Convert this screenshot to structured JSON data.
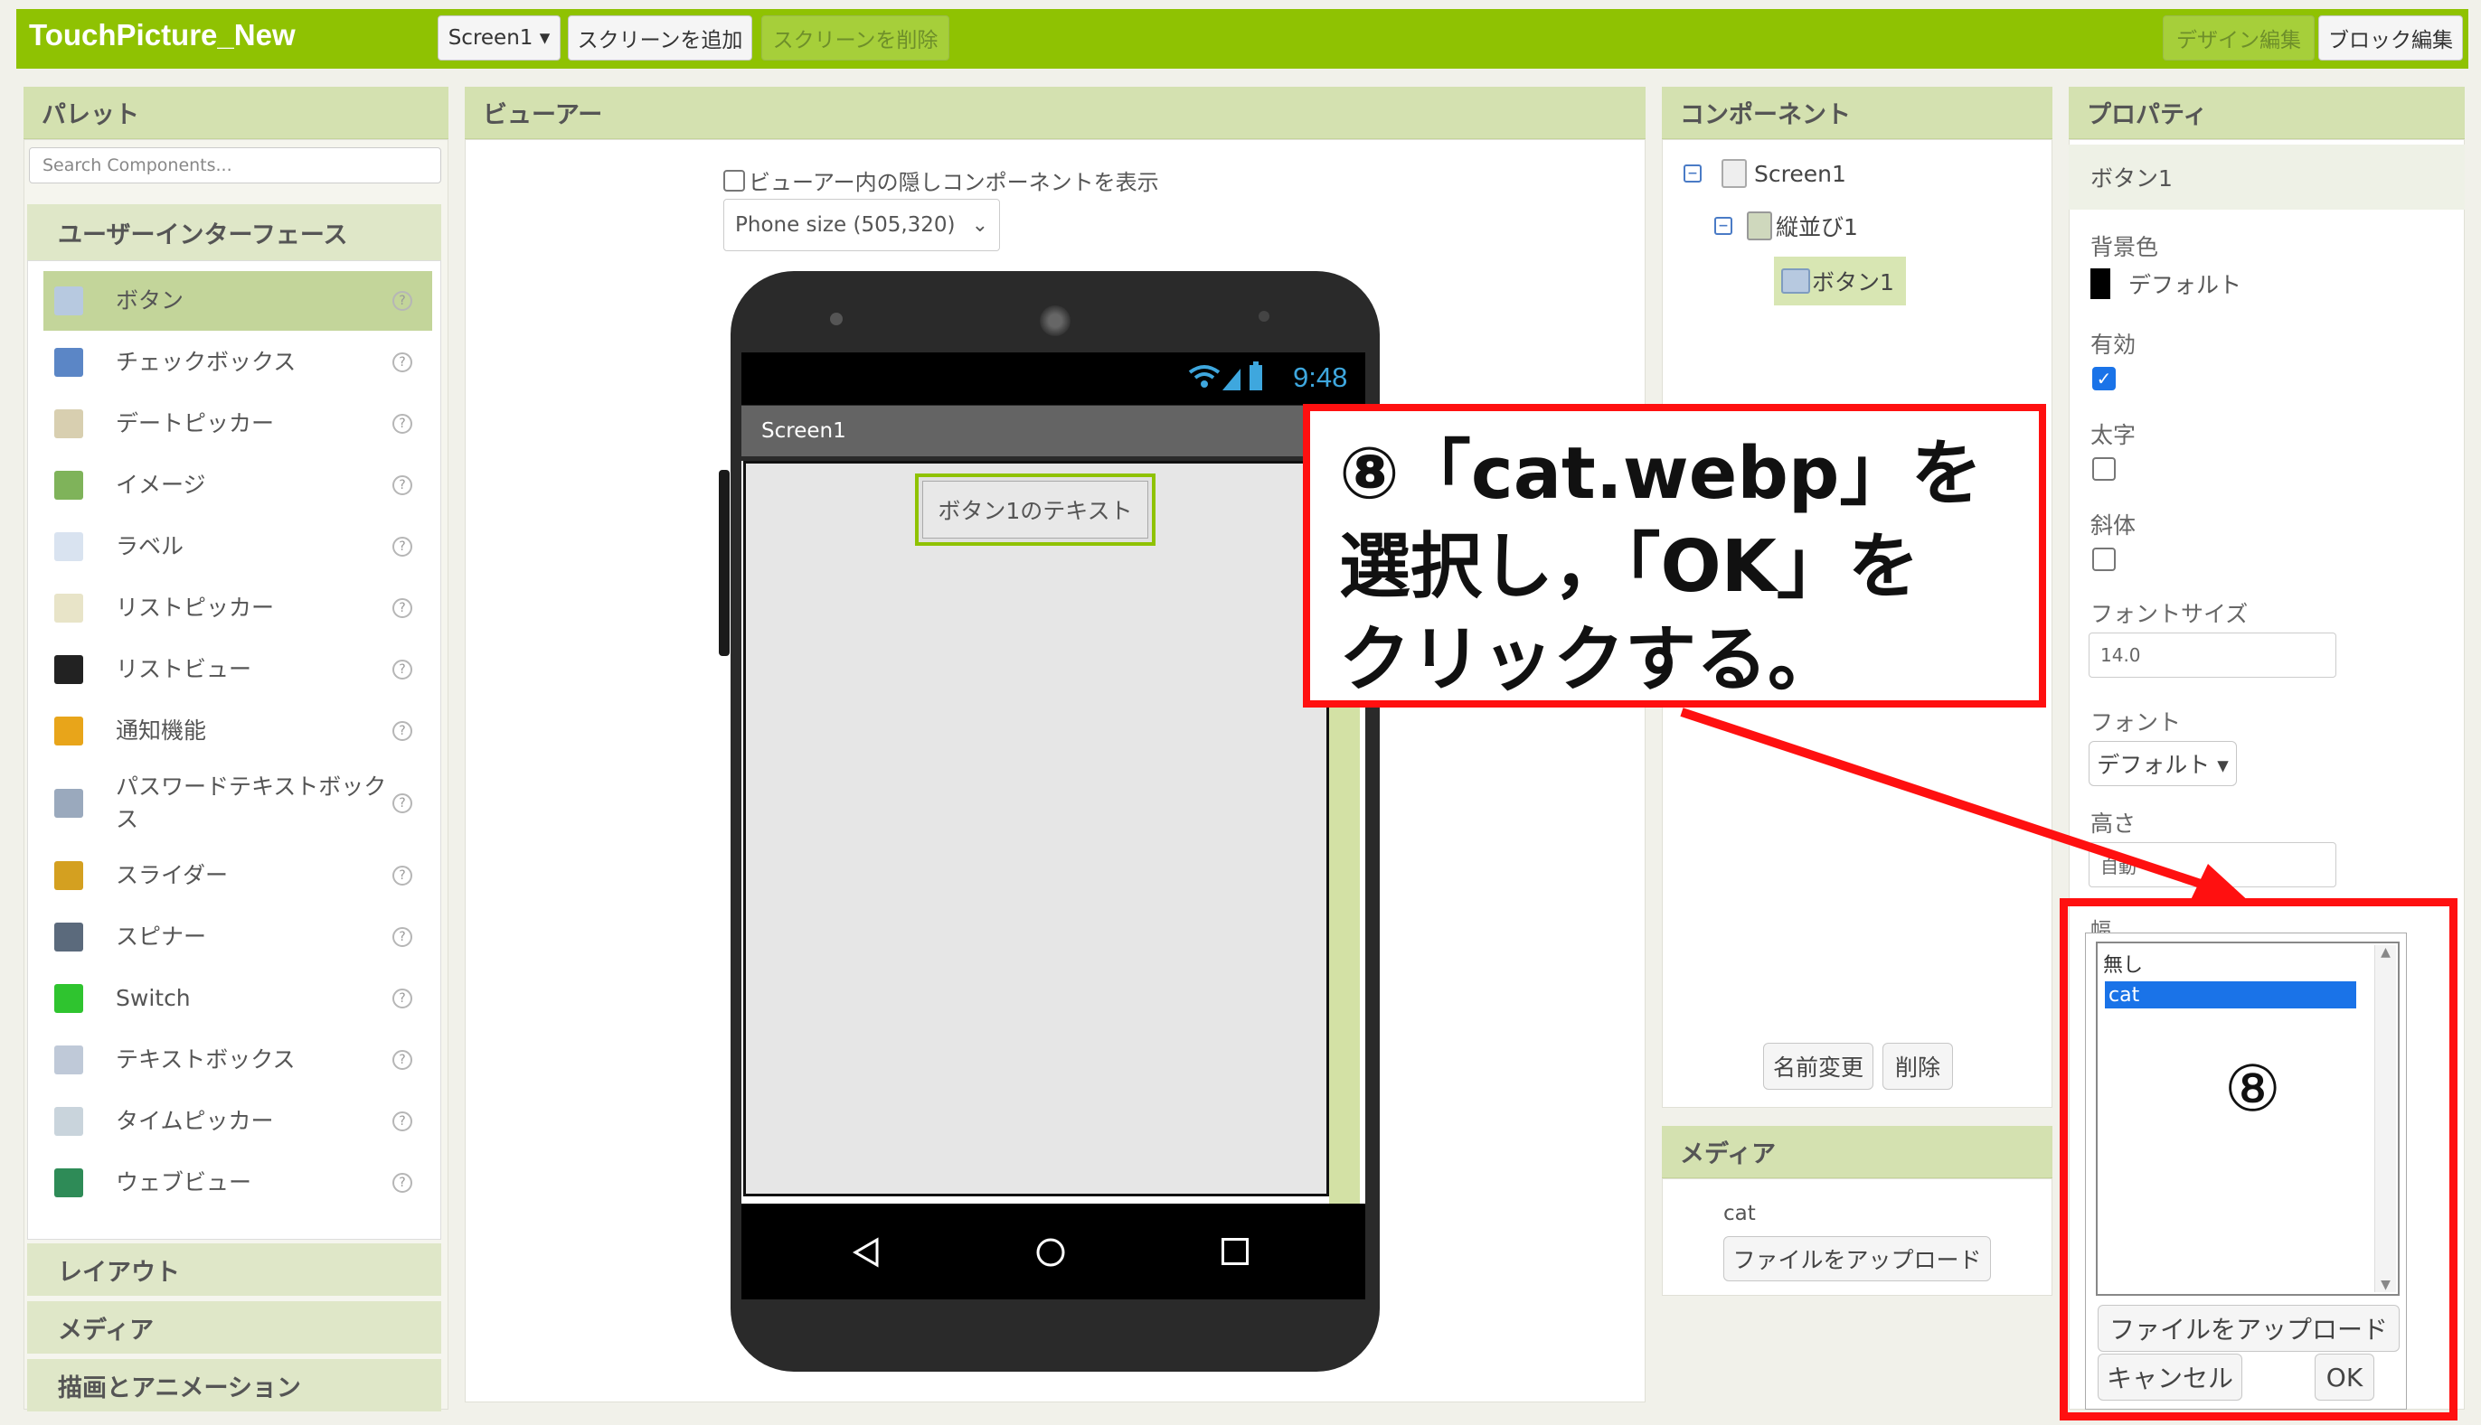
{
  "app": {
    "title": "TouchPicture_New"
  },
  "toolbar": {
    "screen_select": "Screen1 ▾",
    "add_screen": "スクリーンを追加",
    "remove_screen": "スクリーンを削除",
    "designer": "デザイン編集",
    "blocks": "ブロック編集"
  },
  "palette": {
    "title": "パレット",
    "search_placeholder": "Search Components...",
    "category": "ユーザーインターフェース",
    "help_glyph": "?",
    "items": [
      {
        "label": "ボタン",
        "icon": "button-icon"
      },
      {
        "label": "チェックボックス",
        "icon": "checkbox-icon"
      },
      {
        "label": "デートピッカー",
        "icon": "date-picker-icon"
      },
      {
        "label": "イメージ",
        "icon": "image-icon"
      },
      {
        "label": "ラベル",
        "icon": "label-icon"
      },
      {
        "label": "リストピッカー",
        "icon": "list-picker-icon"
      },
      {
        "label": "リストビュー",
        "icon": "list-view-icon"
      },
      {
        "label": "通知機能",
        "icon": "notifier-icon"
      },
      {
        "label": "パスワードテキストボックス",
        "icon": "password-textbox-icon"
      },
      {
        "label": "スライダー",
        "icon": "slider-icon"
      },
      {
        "label": "スピナー",
        "icon": "spinner-icon"
      },
      {
        "label": "Switch",
        "icon": "switch-icon"
      },
      {
        "label": "テキストボックス",
        "icon": "textbox-icon"
      },
      {
        "label": "タイムピッカー",
        "icon": "time-picker-icon"
      },
      {
        "label": "ウェブビュー",
        "icon": "web-viewer-icon"
      }
    ],
    "collapsed": [
      "レイアウト",
      "メディア",
      "描画とアニメーション"
    ]
  },
  "viewer": {
    "title": "ビューアー",
    "hidden_label": "ビューアー内の隠しコンポーネントを表示",
    "size_select": "Phone size (505,320)",
    "phone_time": "9:48",
    "screen_title": "Screen1",
    "button_text": "ボタン1のテキスト"
  },
  "components": {
    "title": "コンポーネント",
    "tree": [
      "Screen1",
      "縦並び1",
      "ボタン1"
    ],
    "rename": "名前変更",
    "delete": "削除"
  },
  "media": {
    "title": "メディア",
    "file": "cat",
    "upload": "ファイルをアップロード"
  },
  "properties": {
    "title": "プロパティ",
    "component": "ボタン1",
    "bg_label": "背景色",
    "bg_value": "デフォルト",
    "enabled_label": "有効",
    "bold_label": "太字",
    "italic_label": "斜体",
    "fontsize_label": "フォントサイズ",
    "fontsize_value": "14.0",
    "font_label": "フォント",
    "font_value": "デフォルト ▾",
    "height_label": "高さ",
    "height_value": "自動",
    "width_label": "幅"
  },
  "picker": {
    "options": [
      "無し",
      "cat"
    ],
    "selected": "cat",
    "step_mark": "⑧",
    "upload": "ファイルをアップロード",
    "cancel": "キャンセル",
    "ok": "OK"
  },
  "callout": {
    "line1": "⑧「cat.webp」を",
    "line2": "選択し，「OK」を",
    "line3": "クリックする。"
  },
  "colors": {
    "brand_green": "#8fc202",
    "highlight_red": "#ff1010",
    "selection_blue": "#1a73e8"
  }
}
